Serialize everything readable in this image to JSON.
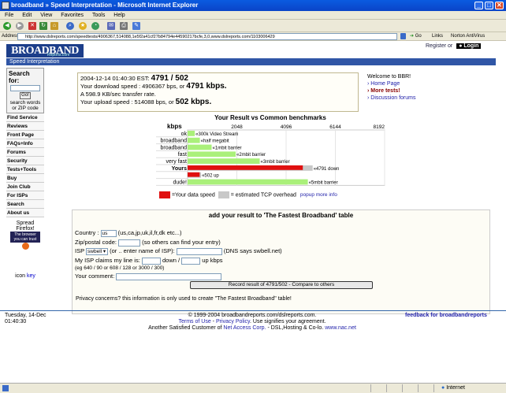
{
  "window": {
    "title": "broadband » Speed Interpretation - Microsoft Internet Explorer",
    "min": "_",
    "max": "□",
    "close": "✕"
  },
  "menu": [
    "File",
    "Edit",
    "View",
    "Favorites",
    "Tools",
    "Help"
  ],
  "address": {
    "label": "Address",
    "url": "http://www.dslreports.com/speedtests/4906367,514088,1e5f2a41cf27b84794e44590217bcfe,3,0,www.dslreports.com/1103006429",
    "go": "Go",
    "links": "Links",
    "norton": "Norton AntiVirus"
  },
  "site": {
    "logo": "BROADBAND",
    "logo_sub": "Reports.com",
    "register": "Register or",
    "login": "Login",
    "section": "Speed Interpretation"
  },
  "sidebar": {
    "search_title": "Search for:",
    "go": "Go!",
    "search_help": "search words or ZIP code",
    "nav": [
      "Find Service",
      "Reviews",
      "Front Page",
      "FAQs+Info",
      "Forums",
      "Security",
      "Tests+Tools",
      "Buy",
      "Join Club",
      "For ISPs",
      "Search",
      "About us"
    ],
    "firefox_line1": "Spread",
    "firefox_line2": "Firefox!",
    "firefox_badge": "The browser you can trust",
    "icon_key_prefix": "icon",
    "icon_key_link": "key"
  },
  "stats": {
    "date": "2004-12-14 01:40:30 EST:",
    "result": "4791 / 502",
    "dl_prefix": "Your download speed : 4906367 bps, or",
    "dl_kbps": "4791 kbps.",
    "transfer": "A 598.9 KB/sec transfer rate.",
    "ul_prefix": "Your upload speed : 514088 bps, or",
    "ul_kbps": "502 kbps."
  },
  "welcome": {
    "title": "Welcome to BBR!",
    "links": [
      "Home Page",
      "More tests!",
      "Discussion forums"
    ]
  },
  "chart_title": "Your Result vs Common benchmarks",
  "chart_data": {
    "type": "bar",
    "xlabel": "kbps",
    "xlim": [
      0,
      8192
    ],
    "ticks": [
      "2048",
      "4096",
      "6144",
      "8192"
    ],
    "tick_values": [
      2048,
      4096,
      6144,
      8192
    ],
    "rows": [
      {
        "label": "ok",
        "value": 300,
        "text": "«300k Video Stream",
        "kind": "bench"
      },
      {
        "label": "broadband",
        "value": 512,
        "text": "«half megabit",
        "kind": "bench"
      },
      {
        "label": "broadband",
        "value": 1000,
        "text": "«1mbit barrier",
        "kind": "bench"
      },
      {
        "label": "fast",
        "value": 2000,
        "text": "«2mbit barrier",
        "kind": "bench"
      },
      {
        "label": "very fast",
        "value": 3000,
        "text": "«3mbit barrier",
        "kind": "bench"
      },
      {
        "label": "Yours",
        "value": 4791,
        "overhead": 5200,
        "text": "«4791 down",
        "kind": "yours"
      },
      {
        "label": "",
        "value": 502,
        "overhead": 560,
        "text": "«502 up",
        "kind": "yours"
      },
      {
        "label": "dude!",
        "value": 5000,
        "text": "«5mbit barrier",
        "kind": "bench"
      }
    ],
    "colors": {
      "yours": "#e01010",
      "bench": "#aaf07a",
      "overhead": "#c8c8c8",
      "bench_pale": "#d6fbb8"
    }
  },
  "legend": {
    "yours": "=Your data speed",
    "overhead": "= estimated TCP overhead",
    "popup": "popup more info"
  },
  "form": {
    "header": "add your result to 'The Fastest Broadband' table",
    "country_label": "Country :",
    "country_value": "us",
    "country_help": "(us,ca,jp,uk,il,fr,dk etc...)",
    "zip_label": "Zip/postal code:",
    "zip_help": "(so others can find your entry)",
    "isp_label": "ISP",
    "isp_value": "swbell",
    "isp_or": "(or .. enter name of ISP):",
    "isp_help": "(DNS says swbell.net)",
    "claim_label": "My ISP claims my line is:",
    "claim_down": "down /",
    "claim_up": "up kbps",
    "claim_eg": "(eg 640 / 90 or 608 / 128 or 3000 / 300)",
    "comment_label": "Your comment:",
    "submit": "Record result of 4791/502 - Compare to others",
    "privacy": "Privacy concerns? this information is only used to create \"The Fastest Broadband\" table!"
  },
  "footer": {
    "date": "Tuesday, 14-Dec",
    "time": "01:40:30",
    "copyright": "© 1999-2004 broadbandreports.com/dslreports.com.",
    "terms": "Terms of Use",
    "privacy": "Privacy Policy",
    "agree": "Use signifies your agreement.",
    "customer_prefix": "Another Satisfied Customer of",
    "netaccess": "Net Access Corp.",
    "hosting": "- DSL,Hosting & Co-lo.",
    "nac": "www.nac.net",
    "feedback": "feedback for broadbandreports"
  },
  "status": {
    "zone": "Internet"
  }
}
